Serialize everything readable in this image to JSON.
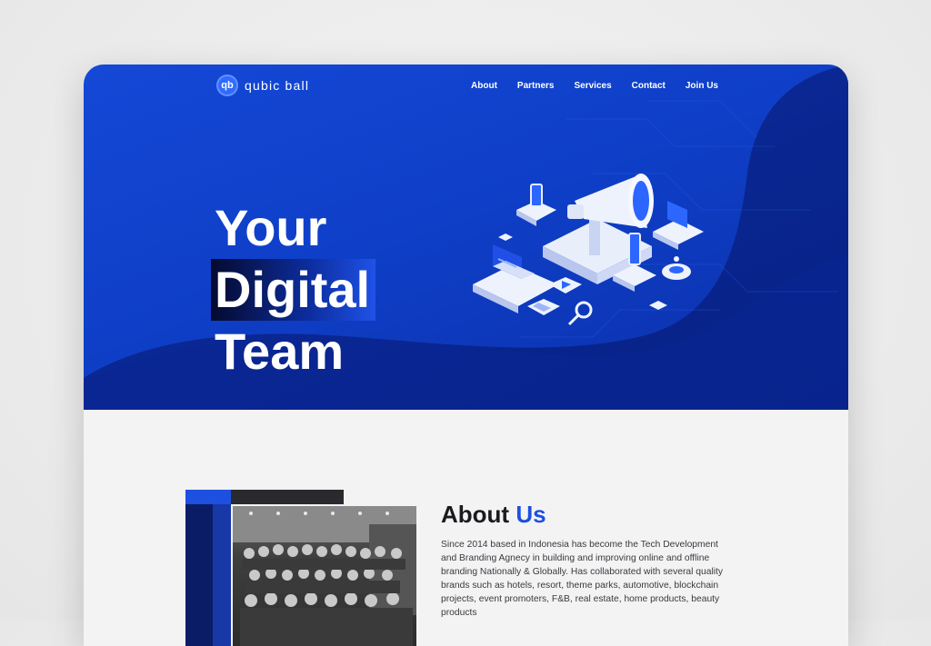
{
  "brand": {
    "logo_mark": "qb",
    "name": "qubic ball"
  },
  "nav": {
    "items": [
      {
        "label": "About"
      },
      {
        "label": "Partners"
      },
      {
        "label": "Services"
      },
      {
        "label": "Contact"
      },
      {
        "label": "Join Us"
      }
    ]
  },
  "hero": {
    "line1": "Your",
    "line2": "Digital",
    "line3": "Team",
    "illustration_icon": "megaphone-isometric-icon"
  },
  "about": {
    "title_main": "About",
    "title_accent": "Us",
    "body": "Since 2014 based in Indonesia has become the Tech Development and Branding Agnecy in building and improving online and offline branding Nationally & Globally. Has collaborated with several quality brands such as hotels, resort, theme parks, automotive, blockchain projects, event promoters, F&B, real estate, home products, beauty products"
  },
  "colors": {
    "primary": "#1448d6",
    "primary_dark": "#0a2fa8",
    "accent": "#1d4fe0",
    "text_dark": "#1b1b1f"
  }
}
